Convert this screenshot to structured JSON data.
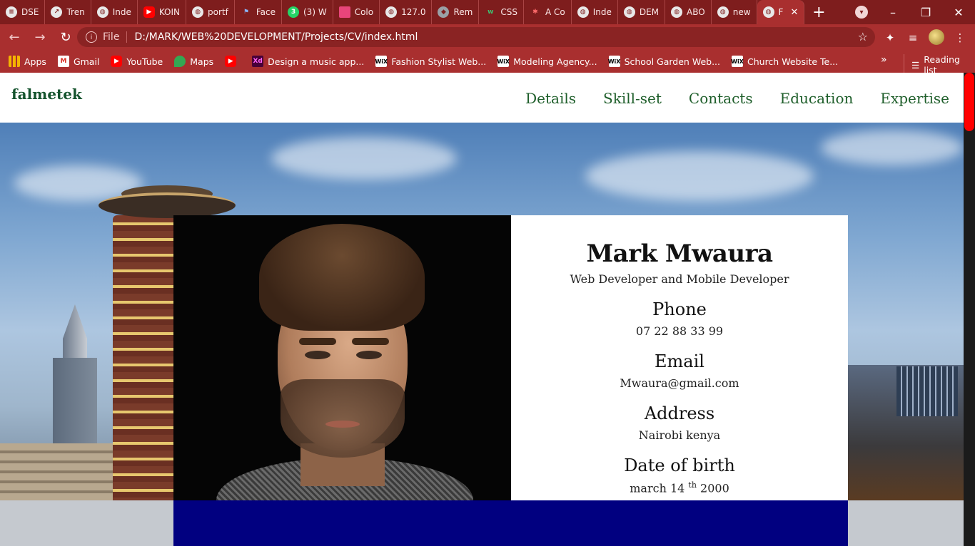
{
  "browser": {
    "tabs": [
      {
        "label": "DSE",
        "icon": "document-icon"
      },
      {
        "label": "Tren",
        "icon": "trending-icon"
      },
      {
        "label": "Inde",
        "icon": "globe-icon"
      },
      {
        "label": "KOIN",
        "icon": "youtube-icon"
      },
      {
        "label": "portf",
        "icon": "globe-icon"
      },
      {
        "label": "Face",
        "icon": "flag-icon"
      },
      {
        "label": "(3) W",
        "icon": "whatsapp-icon"
      },
      {
        "label": "Colo",
        "icon": "palette-icon"
      },
      {
        "label": "127.0",
        "icon": "globe-icon"
      },
      {
        "label": "Rem",
        "icon": "layers-icon"
      },
      {
        "label": "CSS",
        "icon": "w3-icon"
      },
      {
        "label": "A Co",
        "icon": "asterisk-icon"
      },
      {
        "label": "Inde",
        "icon": "globe-icon"
      },
      {
        "label": "DEM",
        "icon": "globe-icon"
      },
      {
        "label": "ABO",
        "icon": "globe-icon"
      },
      {
        "label": "new",
        "icon": "globe-icon"
      },
      {
        "label": "F",
        "icon": "globe-icon",
        "active": true
      }
    ],
    "address": {
      "scheme": "File",
      "url": "D:/MARK/WEB%20DEVELOPMENT/Projects/CV/index.html"
    },
    "bookmarks": [
      {
        "label": "Apps",
        "icon": "apps-icon"
      },
      {
        "label": "Gmail",
        "icon": "gmail-icon"
      },
      {
        "label": "YouTube",
        "icon": "youtube-icon"
      },
      {
        "label": "Maps",
        "icon": "maps-icon"
      },
      {
        "label": "",
        "icon": "youtube-icon"
      },
      {
        "label": "Design a music app...",
        "icon": "xd-icon"
      },
      {
        "label": "Fashion Stylist Web...",
        "icon": "wix-icon"
      },
      {
        "label": "Modeling Agency...",
        "icon": "wix-icon"
      },
      {
        "label": "School Garden Web...",
        "icon": "wix-icon"
      },
      {
        "label": "Church Website Te...",
        "icon": "wix-icon"
      }
    ],
    "more_bookmarks": "»",
    "reading_list": "Reading list"
  },
  "site": {
    "brand": "falmetek",
    "nav": [
      "Details",
      "Skill-set",
      "Contacts",
      "Education",
      "Expertise"
    ],
    "profile": {
      "name": "Mark Mwaura",
      "role": "Web Developer and Mobile Developer",
      "phone_label": "Phone",
      "phone": "07 22 88 33 99",
      "email_label": "Email",
      "email": "Mwaura@gmail.com",
      "address_label": "Address",
      "address": "Nairobi kenya",
      "dob_label": "Date of birth",
      "dob_month_day": "march 14",
      "dob_suffix": "th",
      "dob_year": "2000"
    }
  },
  "colors": {
    "chrome": "#a92f2f",
    "brand_green": "#14532d",
    "bottom_bar": "#010080",
    "scroll_thumb": "#ff0000"
  }
}
